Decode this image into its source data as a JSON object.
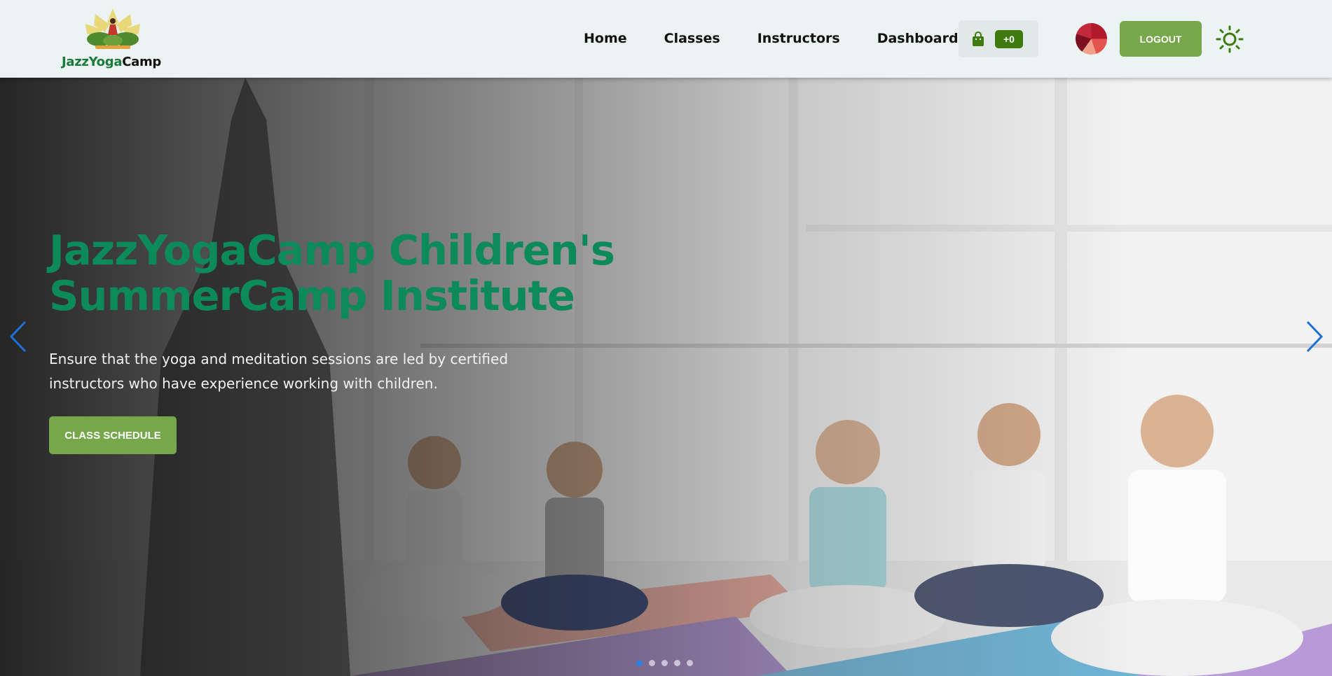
{
  "brand": {
    "name_part1": "JazzYoga",
    "name_part2": "Camp"
  },
  "nav": {
    "links": [
      "Home",
      "Classes",
      "Instructors",
      "Dashboard"
    ],
    "cart_count": "+0",
    "logout_label": "LOGOUT"
  },
  "hero": {
    "title": "JazzYogaCamp Children's SummerCamp Institute",
    "description": "Ensure that the yoga and meditation sessions are led by certified instructors who have experience working with children.",
    "cta_label": "CLASS SCHEDULE",
    "slide_count": 5,
    "active_slide": 1
  },
  "colors": {
    "nav_bg": "#ecf3f3",
    "accent_green": "#76a74a",
    "title_green": "#0d8a5a",
    "badge_green": "#3f7a10",
    "active_dot": "#2f7fe0",
    "arrow_blue": "#1e6fd6"
  },
  "icons": [
    "logo-lotus-icon",
    "shopping-bag-icon",
    "sun-icon",
    "chevron-left-icon",
    "chevron-right-icon"
  ]
}
